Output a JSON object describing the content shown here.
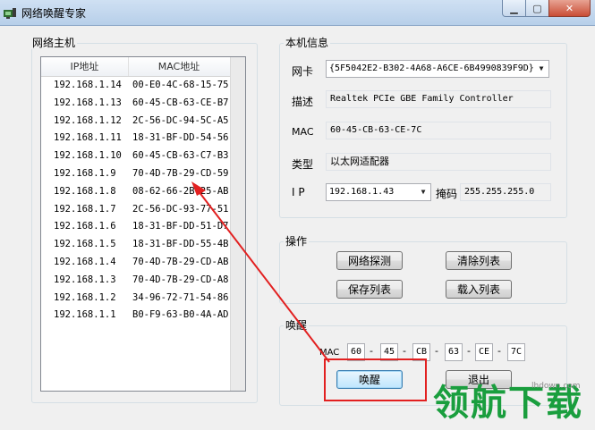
{
  "window": {
    "title": "网络唤醒专家",
    "min_glyph": "▁",
    "max_glyph": "▢",
    "close_glyph": "✕"
  },
  "hosts_group": {
    "legend": "网络主机",
    "columns": [
      "IP地址",
      "MAC地址"
    ],
    "rows": [
      {
        "ip": "192.168.1.14",
        "mac": "00-E0-4C-68-15-75"
      },
      {
        "ip": "192.168.1.13",
        "mac": "60-45-CB-63-CE-B7"
      },
      {
        "ip": "192.168.1.12",
        "mac": "2C-56-DC-94-5C-A5"
      },
      {
        "ip": "192.168.1.11",
        "mac": "18-31-BF-DD-54-56"
      },
      {
        "ip": "192.168.1.10",
        "mac": "60-45-CB-63-C7-B3"
      },
      {
        "ip": "192.168.1.9",
        "mac": "70-4D-7B-29-CD-59"
      },
      {
        "ip": "192.168.1.8",
        "mac": "08-62-66-2B-25-AB"
      },
      {
        "ip": "192.168.1.7",
        "mac": "2C-56-DC-93-77-51"
      },
      {
        "ip": "192.168.1.6",
        "mac": "18-31-BF-DD-51-D7"
      },
      {
        "ip": "192.168.1.5",
        "mac": "18-31-BF-DD-55-4B"
      },
      {
        "ip": "192.168.1.4",
        "mac": "70-4D-7B-29-CD-AB"
      },
      {
        "ip": "192.168.1.3",
        "mac": "70-4D-7B-29-CD-A8"
      },
      {
        "ip": "192.168.1.2",
        "mac": "34-96-72-71-54-86"
      },
      {
        "ip": "192.168.1.1",
        "mac": "B0-F9-63-B0-4A-AD"
      }
    ]
  },
  "local_info": {
    "legend": "本机信息",
    "nic_label": "网卡",
    "nic_value": "{5F5042E2-B302-4A68-A6CE-6B4990839F9D}",
    "desc_label": "描述",
    "desc_value": "Realtek PCIe GBE Family Controller",
    "mac_label": "MAC",
    "mac_value": "60-45-CB-63-CE-7C",
    "type_label": "类型",
    "type_value": "以太网适配器",
    "ip_label": "I P",
    "ip_value": "192.168.1.43",
    "mask_label": "掩码",
    "mask_value": "255.255.255.0"
  },
  "operations": {
    "legend": "操作",
    "detect": "网络探测",
    "clear": "清除列表",
    "save": "保存列表",
    "load": "载入列表"
  },
  "wake": {
    "legend": "唤醒",
    "mac_label": "MAC",
    "octets": [
      "60",
      "45",
      "CB",
      "63",
      "CE",
      "7C"
    ],
    "separator": "-",
    "wake_button": "唤醒",
    "exit_button": "退出"
  },
  "watermark": {
    "text": "领航下载",
    "url": "lhdown.com"
  },
  "colors": {
    "annotation_red": "#e22020",
    "watermark_green": "#1a9e3e"
  }
}
